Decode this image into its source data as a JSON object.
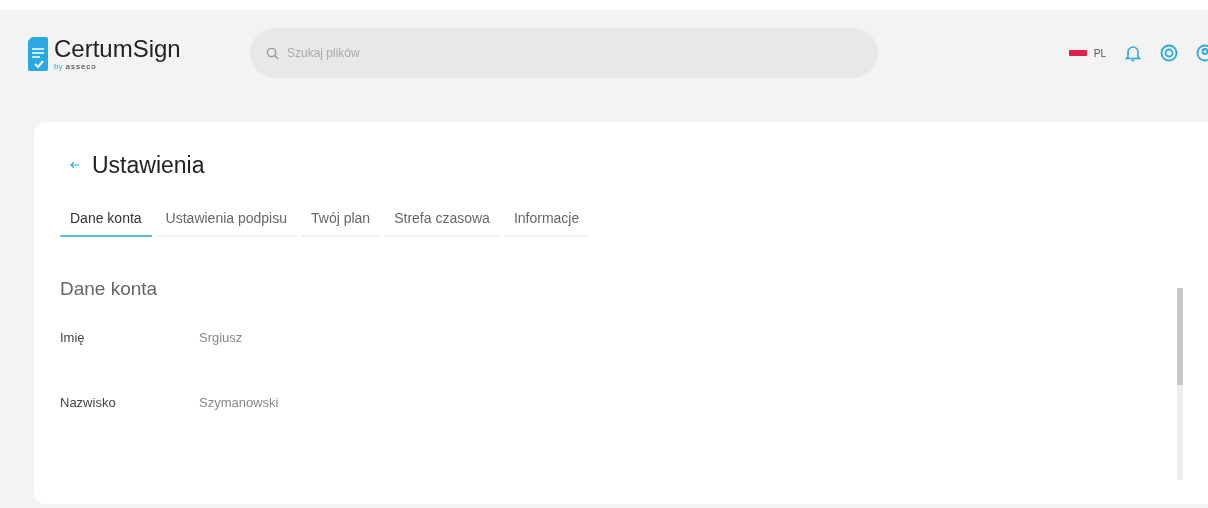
{
  "header": {
    "logo": {
      "name": "CertumSign",
      "by": "by",
      "company": "asseco"
    },
    "search": {
      "placeholder": "Szukaj plików"
    },
    "language": "PL"
  },
  "page": {
    "title": "Ustawienia",
    "tabs": [
      {
        "label": "Dane konta",
        "selected": true
      },
      {
        "label": "Ustawienia podpisu",
        "selected": false
      },
      {
        "label": "Twój plan",
        "selected": false
      },
      {
        "label": "Strefa czasowa",
        "selected": false
      },
      {
        "label": "Informacje",
        "selected": false
      }
    ],
    "section": {
      "title": "Dane konta",
      "fields": [
        {
          "label": "Imię",
          "value": "Srgiusz"
        },
        {
          "label": "Nazwisko",
          "value": "Szymanowski"
        }
      ]
    }
  }
}
